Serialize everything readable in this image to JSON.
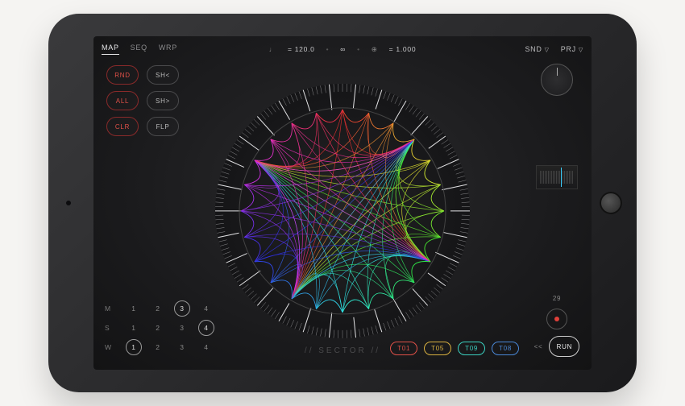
{
  "tabs": {
    "map": "MAP",
    "seq": "SEQ",
    "wrp": "WRP",
    "active": "map"
  },
  "topCenter": {
    "tempo": "= 120.0",
    "link": "∞",
    "ratio": "= 1.000"
  },
  "topRight": {
    "snd": "SND",
    "prj": "PRJ"
  },
  "leftPills": {
    "col1": {
      "rnd": "RND",
      "all": "ALL",
      "clr": "CLR"
    },
    "col2": {
      "shl": "SH<",
      "shr": "SH>",
      "flp": "FLP"
    }
  },
  "msw": {
    "rows": [
      {
        "label": "M",
        "cells": [
          "1",
          "2",
          "3",
          "4"
        ],
        "circled": [
          2
        ]
      },
      {
        "label": "S",
        "cells": [
          "1",
          "2",
          "3",
          "4"
        ],
        "circled": [
          3
        ]
      },
      {
        "label": "W",
        "cells": [
          "1",
          "2",
          "3",
          "4"
        ],
        "circled": [
          0
        ]
      }
    ]
  },
  "sectorLabel": "// SECTOR //",
  "tags": [
    {
      "label": "T01",
      "color": "#e05048"
    },
    {
      "label": "T05",
      "color": "#d8b040"
    },
    {
      "label": "T09",
      "color": "#3bd1c0"
    },
    {
      "label": "T08",
      "color": "#4a88d8"
    }
  ],
  "rightCol": {
    "recNumber": "29",
    "rewind": "<<",
    "run": "RUN"
  }
}
